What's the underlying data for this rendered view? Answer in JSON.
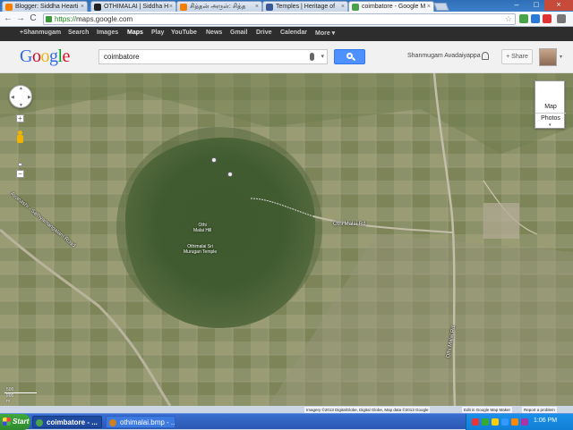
{
  "browser": {
    "tabs": [
      {
        "title": "Blogger: Siddha Hearti",
        "favicon_color": "#f57d00",
        "active": false
      },
      {
        "title": "OTHIMALAI | Siddha H",
        "favicon_color": "#222222",
        "active": false
      },
      {
        "title": "சித்தன் அருள்: சித்த",
        "favicon_color": "#f57d00",
        "active": false
      },
      {
        "title": "Temples | Heritage of",
        "favicon_color": "#3b5998",
        "active": false
      },
      {
        "title": "coimbatore - Google M",
        "favicon_color": "#4aa34a",
        "active": true
      }
    ],
    "tab_close_glyph": "×",
    "window_controls": {
      "minimize": "–",
      "maximize": "□",
      "close": "×"
    },
    "nav": {
      "back": "←",
      "forward": "→",
      "reload": "C"
    },
    "address": {
      "scheme": "https://",
      "rest": "maps.google.com"
    },
    "bookmark_star": "☆"
  },
  "google_bar": {
    "items": [
      "+Shanmugam",
      "Search",
      "Images",
      "Maps",
      "Play",
      "YouTube",
      "News",
      "Gmail",
      "Drive",
      "Calendar",
      "More ▾"
    ],
    "active": "Maps"
  },
  "header": {
    "logo_letters": [
      {
        "char": "G",
        "color": "#3369e8"
      },
      {
        "char": "o",
        "color": "#d50f25"
      },
      {
        "char": "o",
        "color": "#eeb211"
      },
      {
        "char": "g",
        "color": "#3369e8"
      },
      {
        "char": "l",
        "color": "#009925"
      },
      {
        "char": "e",
        "color": "#d50f25"
      }
    ],
    "search_value": "coimbatore",
    "dropdown_glyph": "▾",
    "user_name": "Shanmugam Avadaiyappa",
    "share_label": "+ Share",
    "avatar_dropdown_glyph": "▾"
  },
  "map": {
    "type_control": {
      "map_label": "Map",
      "photos_label": "Photos",
      "arrow": "▾"
    },
    "pan": {
      "up": "▲",
      "down": "▼",
      "left": "◀",
      "right": "▶"
    },
    "zoom": {
      "in": "+",
      "out": "−"
    },
    "labels": {
      "hill": "Othi\nMalai Hill",
      "temple": "Othimalai Sri\nMurugan Temple",
      "road_right": "Othi Malai Rd",
      "road_vertical": "Othi Malai Rd",
      "road_left": "Avanashi - Sathyamangalam Road"
    },
    "scale": {
      "feet": "500 ft",
      "meters": "200 m"
    },
    "attribution": {
      "imagery": "Imagery ©2013 DigitalGlobe, Digital Globe, Map data ©2013 Google",
      "edit": "Edit in Google Map Maker",
      "report": "Report a problem"
    }
  },
  "taskbar": {
    "start_label": "Start",
    "items": [
      {
        "label": "coimbatore - ...",
        "icon_color": "#4aa34a",
        "active": true
      },
      {
        "label": "othimalai.bmp - ...",
        "icon_color": "#d08020",
        "active": false
      }
    ],
    "clock": "1:06 PM",
    "tray_colors": [
      "#e33",
      "#3a3",
      "#fc0",
      "#39f",
      "#f80",
      "#a3a"
    ]
  }
}
